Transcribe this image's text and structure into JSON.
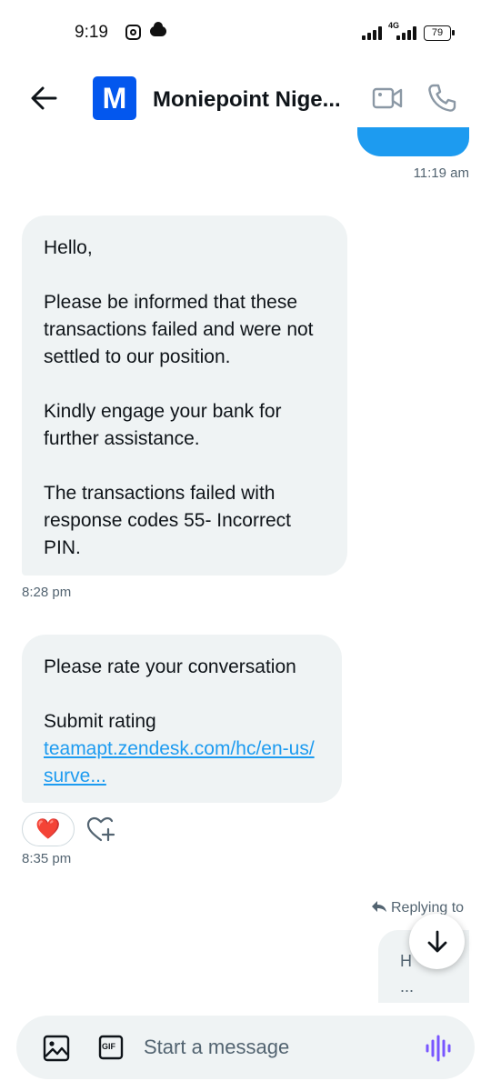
{
  "status_bar": {
    "time": "9:19",
    "network_type": "4G",
    "battery": "79",
    "icons": [
      "instagram-icon",
      "cloud-icon",
      "signal-icon",
      "battery-icon"
    ]
  },
  "header": {
    "avatar_letter": "M",
    "title": "Moniepoint Nige...",
    "accent_color": "#0357ee",
    "icons": [
      "back-arrow-icon",
      "video-call-icon",
      "phone-call-icon"
    ]
  },
  "messages": {
    "sent_time": "11:19 am",
    "received_1": {
      "text": "Hello,\n\nPlease be informed that these transactions failed and were not settled to our position.\n\nKindly engage your bank for further assistance.\n\nThe transactions failed with response codes 55- Incorrect PIN.",
      "time": "8:28 pm"
    },
    "received_2": {
      "line1": "Please rate your conversation",
      "line2": "Submit rating",
      "link": "teamapt.zendesk.com/hc/en-us/surve...",
      "time": "8:35 pm",
      "reaction": "❤️"
    },
    "reply": {
      "label": "Replying to",
      "preview_line1": "H",
      "preview_line2": "..."
    }
  },
  "composer": {
    "placeholder": "Start a message",
    "gif_label": "GIF"
  },
  "colors": {
    "sent_bubble": "#1d9bf0",
    "received_bubble": "#eff3f4",
    "link": "#1d9bf0",
    "voice": "#7856ff"
  }
}
